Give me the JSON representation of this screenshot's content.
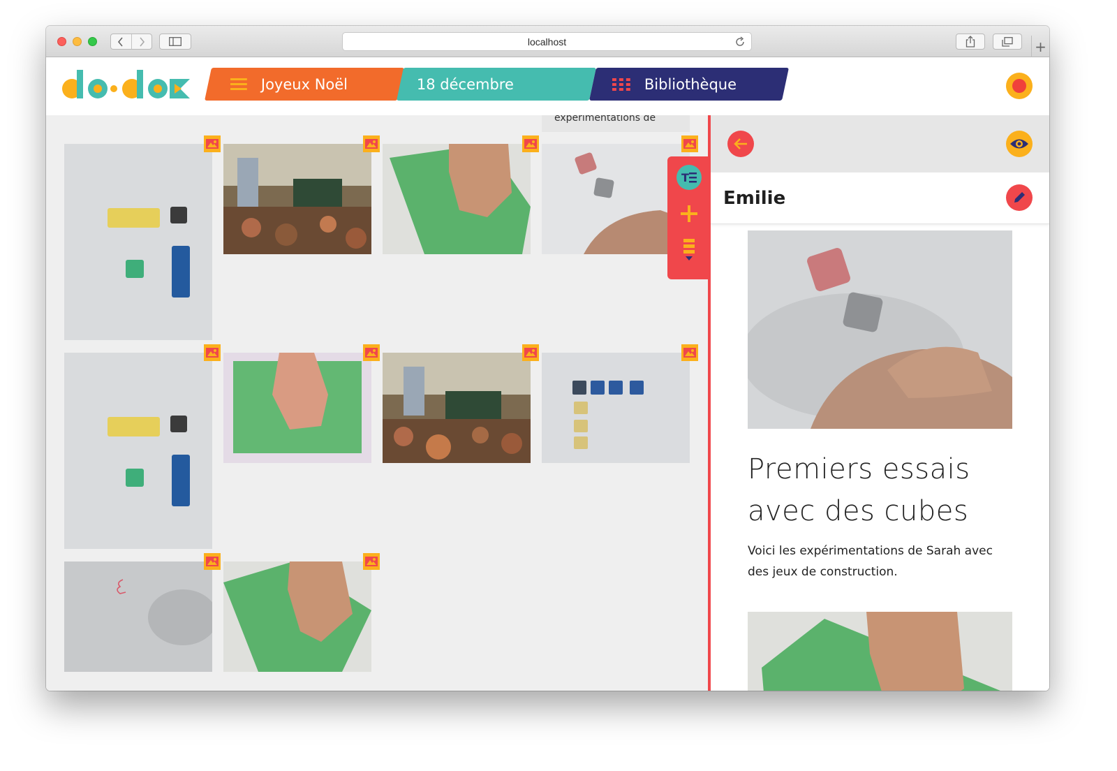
{
  "browser": {
    "url": "localhost"
  },
  "header": {
    "logo_text": "do•dok",
    "tabs": [
      {
        "label": "Joyeux Noël",
        "icon": "hamburger-icon",
        "color": "#f26b2b"
      },
      {
        "label": "18 décembre",
        "color": "#45bcaf"
      },
      {
        "label": "Bibliothèque",
        "icon": "grid-icon",
        "color": "#2c2e75"
      }
    ]
  },
  "media_grid": {
    "partial_caption": "expérimentations de",
    "tiles": [
      {
        "row": 1,
        "col": 1,
        "subject": "cubes-on-table",
        "type": "image"
      },
      {
        "row": 1,
        "col": 2,
        "subject": "classroom",
        "type": "image"
      },
      {
        "row": 1,
        "col": 3,
        "subject": "hand-green-paper",
        "type": "image"
      },
      {
        "row": 1,
        "col": 4,
        "subject": "cubes-hand",
        "type": "image"
      },
      {
        "row": 2,
        "col": 1,
        "subject": "cubes-on-table",
        "type": "image"
      },
      {
        "row": 2,
        "col": 2,
        "subject": "hand-on-green-sheet",
        "type": "image"
      },
      {
        "row": 2,
        "col": 3,
        "subject": "classroom",
        "type": "image"
      },
      {
        "row": 2,
        "col": 4,
        "subject": "cube-rows",
        "type": "image"
      },
      {
        "row": 3,
        "col": 1,
        "subject": "grey-sheet",
        "type": "image"
      },
      {
        "row": 3,
        "col": 2,
        "subject": "hand-green-paper",
        "type": "image"
      }
    ]
  },
  "side_toolbar": {
    "items": [
      "text-icon",
      "plus-icon",
      "list-icon"
    ]
  },
  "panel": {
    "author": "Emilie",
    "title": "Premiers essais avec des cubes",
    "text": "Voici les expérimentations de Sarah avec des jeux de construction."
  },
  "colors": {
    "red": "#f0474b",
    "yellow": "#fbb01c",
    "teal": "#45bcaf",
    "orange": "#f26b2b",
    "navy": "#2c2e75"
  }
}
